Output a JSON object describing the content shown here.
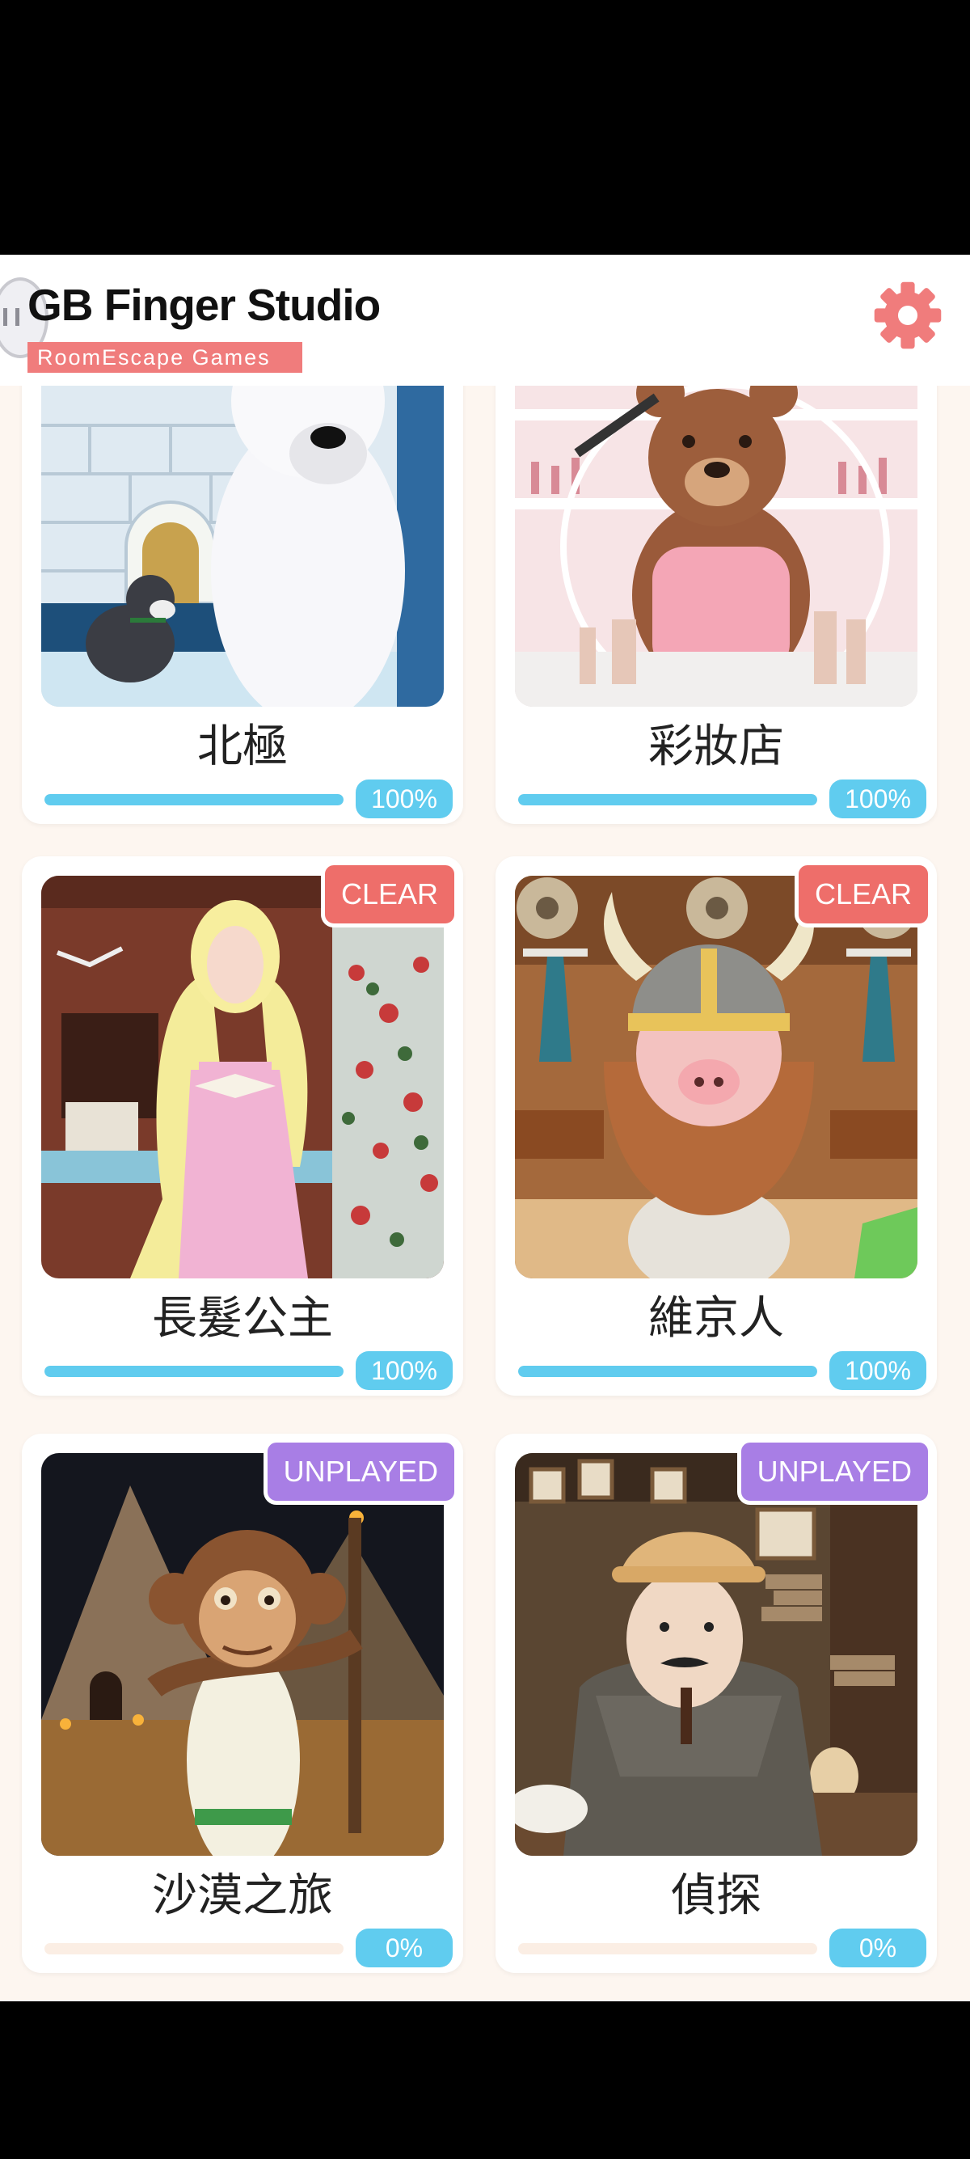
{
  "header": {
    "logo_title": "GB Finger Studio",
    "logo_subtitle": "RoomEscape  Games",
    "settings_icon": "gear-icon"
  },
  "colors": {
    "accent": "#f07c7c",
    "progress": "#60ccef",
    "clear_badge": "#ee6e6a",
    "unplayed_badge": "#a87ee5",
    "background": "#fdf6f0"
  },
  "games": [
    {
      "title": "北極",
      "progress": 1.0,
      "progress_label": "100%",
      "badge": ""
    },
    {
      "title": "彩妝店",
      "progress": 1.0,
      "progress_label": "100%",
      "badge": ""
    },
    {
      "title": "長髮公主",
      "progress": 1.0,
      "progress_label": "100%",
      "badge": "CLEAR"
    },
    {
      "title": "維京人",
      "progress": 1.0,
      "progress_label": "100%",
      "badge": "CLEAR"
    },
    {
      "title": "沙漠之旅",
      "progress": 0.0,
      "progress_label": "0%",
      "badge": "UNPLAYED"
    },
    {
      "title": "偵探",
      "progress": 0.0,
      "progress_label": "0%",
      "badge": "UNPLAYED"
    }
  ]
}
